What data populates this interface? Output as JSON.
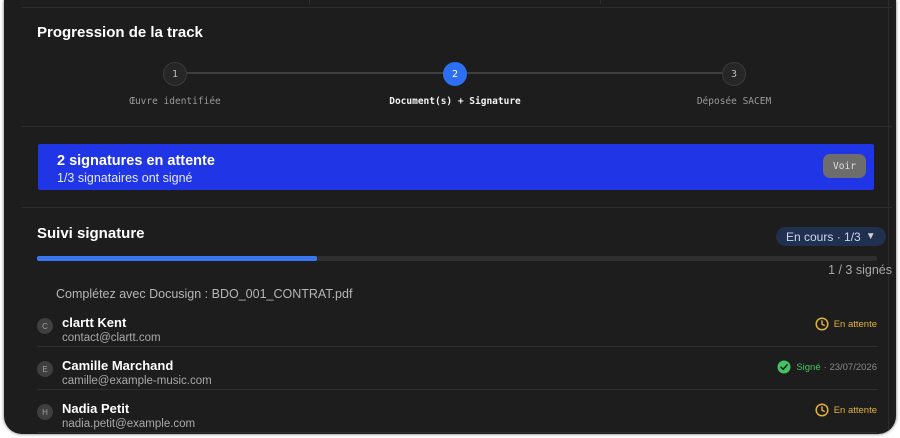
{
  "progress_section": {
    "title": "Progression de la track",
    "steps": [
      {
        "number": "1",
        "label": "Œuvre identifiée",
        "active": false
      },
      {
        "number": "2",
        "label": "Document(s) + Signature",
        "active": true
      },
      {
        "number": "3",
        "label": "Déposée SACEM",
        "active": false
      }
    ]
  },
  "banner": {
    "title": "2 signatures en attente",
    "subtitle": "1/3 signataires ont signé",
    "button_label": "Voir"
  },
  "signature_section": {
    "title": "Suivi signature",
    "status_pill": "En cours · 1/3",
    "status_pill_caret": "▼",
    "progress_fraction": 0.3333,
    "progress_label": "1 / 3 signés",
    "document_line": "Complétez avec Docusign : BDO_001_CONTRAT.pdf",
    "signers": [
      {
        "initial": "C",
        "name": "clartt Kent",
        "email": "contact@clartt.com",
        "status": "En attente",
        "status_type": "pending",
        "date": ""
      },
      {
        "initial": "E",
        "name": "Camille Marchand",
        "email": "camille@example-music.com",
        "status": "Signé",
        "status_type": "signed",
        "date": "· 23/07/2026"
      },
      {
        "initial": "H",
        "name": "Nadia Petit",
        "email": "nadia.petit@example.com",
        "status": "En attente",
        "status_type": "pending",
        "date": ""
      }
    ]
  },
  "colors": {
    "background": "#1d1d1d",
    "accent_blue": "#2d6ff2",
    "banner_blue": "#1f35e6",
    "pending": "#e3b23c",
    "signed": "#43c463"
  },
  "icons": {
    "pending": "clock-icon",
    "signed": "check-circle-icon"
  }
}
